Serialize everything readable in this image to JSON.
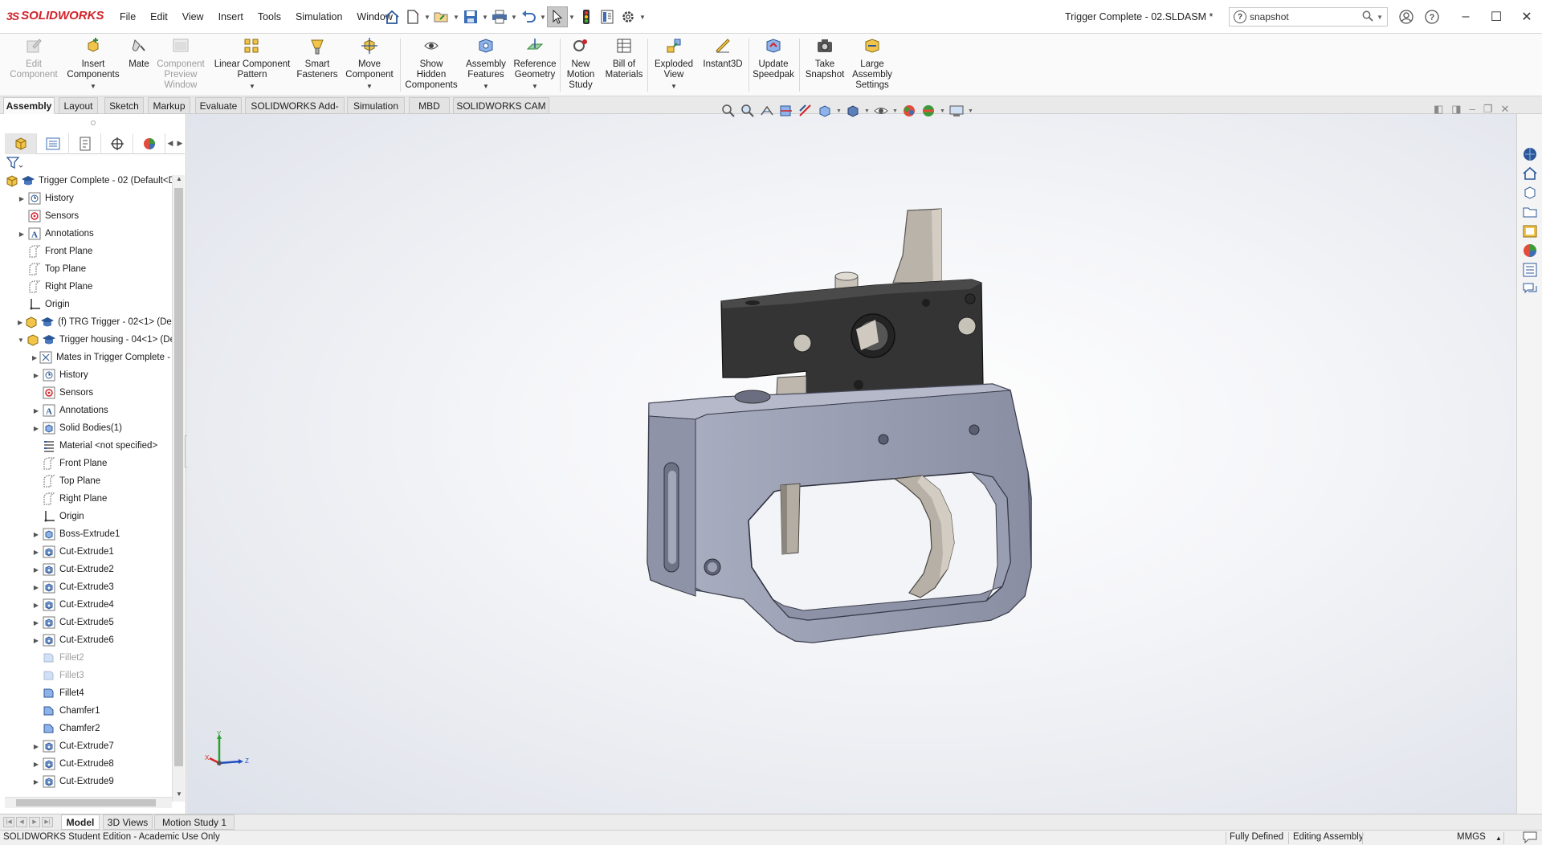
{
  "app": {
    "brand": "SOLIDWORKS",
    "document_title": "Trigger Complete - 02.SLDASM *"
  },
  "menu": [
    "File",
    "Edit",
    "View",
    "Insert",
    "Tools",
    "Simulation",
    "Window"
  ],
  "search": {
    "value": "snapshot"
  },
  "ribbon": [
    {
      "label": "Edit\nComponent",
      "disabled": true,
      "icon": "edit-component-icon"
    },
    {
      "label": "Insert\nComponents",
      "disabled": false,
      "icon": "insert-components-icon",
      "dropdown": true
    },
    {
      "label": "Mate",
      "disabled": false,
      "icon": "mate-icon"
    },
    {
      "label": "Component\nPreview\nWindow",
      "disabled": true,
      "icon": "component-preview-icon"
    },
    {
      "label": "Linear Component\nPattern",
      "disabled": false,
      "icon": "linear-pattern-icon",
      "dropdown": true
    },
    {
      "label": "Smart\nFasteners",
      "disabled": false,
      "icon": "smart-fasteners-icon"
    },
    {
      "label": "Move\nComponent",
      "disabled": false,
      "icon": "move-component-icon",
      "dropdown": true
    },
    {
      "label": "Show\nHidden\nComponents",
      "disabled": false,
      "icon": "show-hidden-icon"
    },
    {
      "label": "Assembly\nFeatures",
      "disabled": false,
      "icon": "assembly-features-icon",
      "dropdown": true
    },
    {
      "label": "Reference\nGeometry",
      "disabled": false,
      "icon": "reference-geometry-icon",
      "dropdown": true
    },
    {
      "label": "New\nMotion\nStudy",
      "disabled": false,
      "icon": "motion-study-icon"
    },
    {
      "label": "Bill of\nMaterials",
      "disabled": false,
      "icon": "bill-of-materials-icon"
    },
    {
      "label": "Exploded\nView",
      "disabled": false,
      "icon": "exploded-view-icon",
      "dropdown": true
    },
    {
      "label": "Instant3D",
      "disabled": false,
      "icon": "instant3d-icon"
    },
    {
      "label": "Update\nSpeedpak",
      "disabled": false,
      "icon": "speedpak-icon"
    },
    {
      "label": "Take\nSnapshot",
      "disabled": false,
      "icon": "snapshot-icon"
    },
    {
      "label": "Large\nAssembly\nSettings",
      "disabled": false,
      "icon": "large-assembly-icon"
    }
  ],
  "command_tabs": [
    "Assembly",
    "Layout",
    "Sketch",
    "Markup",
    "Evaluate",
    "SOLIDWORKS Add-Ins",
    "Simulation",
    "MBD",
    "SOLIDWORKS CAM"
  ],
  "active_command_tab": "Assembly",
  "tree": [
    {
      "label": "Trigger Complete - 02  (Default<D",
      "level": 0,
      "icon": "assembly-icon",
      "expand": ""
    },
    {
      "label": "History",
      "level": 1,
      "icon": "history-icon",
      "expand": "▶"
    },
    {
      "label": "Sensors",
      "level": 1,
      "icon": "sensors-icon",
      "expand": ""
    },
    {
      "label": "Annotations",
      "level": 1,
      "icon": "annotations-icon",
      "expand": "▶"
    },
    {
      "label": "Front Plane",
      "level": 1,
      "icon": "plane-icon",
      "expand": ""
    },
    {
      "label": "Top Plane",
      "level": 1,
      "icon": "plane-icon",
      "expand": ""
    },
    {
      "label": "Right Plane",
      "level": 1,
      "icon": "plane-icon",
      "expand": ""
    },
    {
      "label": "Origin",
      "level": 1,
      "icon": "origin-icon",
      "expand": ""
    },
    {
      "label": "(f) TRG Trigger - 02<1> (Def",
      "level": 1,
      "icon": "part-icon",
      "expand": "▶"
    },
    {
      "label": "Trigger housing - 04<1> (De",
      "level": 1,
      "icon": "part-icon",
      "expand": "▼"
    },
    {
      "label": "Mates in Trigger Complete - 0",
      "level": 2,
      "icon": "mates-icon",
      "expand": "▶"
    },
    {
      "label": "History",
      "level": 2,
      "icon": "history-icon",
      "expand": "▶"
    },
    {
      "label": "Sensors",
      "level": 2,
      "icon": "sensors-icon",
      "expand": ""
    },
    {
      "label": "Annotations",
      "level": 2,
      "icon": "annotations-icon",
      "expand": "▶"
    },
    {
      "label": "Solid Bodies(1)",
      "level": 2,
      "icon": "solid-bodies-icon",
      "expand": "▶"
    },
    {
      "label": "Material <not specified>",
      "level": 2,
      "icon": "material-icon",
      "expand": ""
    },
    {
      "label": "Front Plane",
      "level": 2,
      "icon": "plane-icon",
      "expand": ""
    },
    {
      "label": "Top Plane",
      "level": 2,
      "icon": "plane-icon",
      "expand": ""
    },
    {
      "label": "Right Plane",
      "level": 2,
      "icon": "plane-icon",
      "expand": ""
    },
    {
      "label": "Origin",
      "level": 2,
      "icon": "origin-icon",
      "expand": ""
    },
    {
      "label": "Boss-Extrude1",
      "level": 2,
      "icon": "extrude-icon",
      "expand": "▶"
    },
    {
      "label": "Cut-Extrude1",
      "level": 2,
      "icon": "cut-extrude-icon",
      "expand": "▶"
    },
    {
      "label": "Cut-Extrude2",
      "level": 2,
      "icon": "cut-extrude-icon",
      "expand": "▶"
    },
    {
      "label": "Cut-Extrude3",
      "level": 2,
      "icon": "cut-extrude-icon",
      "expand": "▶"
    },
    {
      "label": "Cut-Extrude4",
      "level": 2,
      "icon": "cut-extrude-icon",
      "expand": "▶"
    },
    {
      "label": "Cut-Extrude5",
      "level": 2,
      "icon": "cut-extrude-icon",
      "expand": "▶"
    },
    {
      "label": "Cut-Extrude6",
      "level": 2,
      "icon": "cut-extrude-icon",
      "expand": "▶"
    },
    {
      "label": "Fillet2",
      "level": 2,
      "icon": "fillet-icon",
      "expand": "",
      "suppressed": true
    },
    {
      "label": "Fillet3",
      "level": 2,
      "icon": "fillet-icon",
      "expand": "",
      "suppressed": true
    },
    {
      "label": "Fillet4",
      "level": 2,
      "icon": "fillet-icon",
      "expand": ""
    },
    {
      "label": "Chamfer1",
      "level": 2,
      "icon": "chamfer-icon",
      "expand": ""
    },
    {
      "label": "Chamfer2",
      "level": 2,
      "icon": "chamfer-icon",
      "expand": ""
    },
    {
      "label": "Cut-Extrude7",
      "level": 2,
      "icon": "cut-extrude-icon",
      "expand": "▶"
    },
    {
      "label": "Cut-Extrude8",
      "level": 2,
      "icon": "cut-extrude-icon",
      "expand": "▶"
    },
    {
      "label": "Cut-Extrude9",
      "level": 2,
      "icon": "cut-extrude-icon",
      "expand": "▶"
    }
  ],
  "triad": {
    "x": "X",
    "y": "Y",
    "z": "Z"
  },
  "bottom_tabs": [
    "Model",
    "3D Views",
    "Motion Study 1"
  ],
  "active_bottom_tab": "Model",
  "status": {
    "left": "SOLIDWORKS Student Edition - Academic Use Only",
    "definition": "Fully Defined",
    "mode": "Editing Assembly",
    "units": "MMGS"
  },
  "colors": {
    "brand_red": "#d2232a",
    "housing": "#8d91a6",
    "black_block": "#333333",
    "trigger": "#b8b2a8"
  }
}
